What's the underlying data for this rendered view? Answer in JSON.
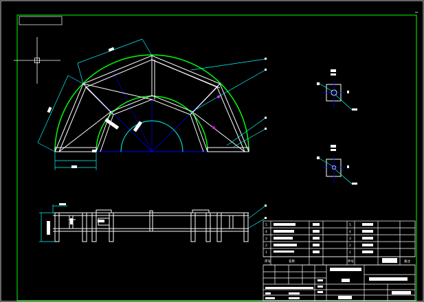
{
  "colors": {
    "background": "#000000",
    "frame": "#00ff00",
    "geometry": "#ffffff",
    "dimension": "#00ffff",
    "guide_arc": "#00ff00",
    "centerline": "#0000ff",
    "marker": "#ff00ff"
  },
  "cursor": {
    "icon": "crosshair-icon"
  },
  "parts_list": {
    "rows": [
      {
        "no": "5",
        "code": "",
        "qty": "",
        "material": ""
      },
      {
        "no": "4",
        "code": "",
        "qty": "",
        "material": ""
      },
      {
        "no": "3",
        "code": "",
        "qty": "",
        "material": ""
      },
      {
        "no": "2",
        "code": "",
        "qty": "",
        "material": ""
      },
      {
        "no": "1",
        "code": "",
        "qty": "",
        "material": ""
      }
    ],
    "header": [
      "序号",
      "名称",
      "件号",
      "备注"
    ]
  },
  "title_block": {
    "drawing_name": "",
    "sheet_text": ""
  }
}
